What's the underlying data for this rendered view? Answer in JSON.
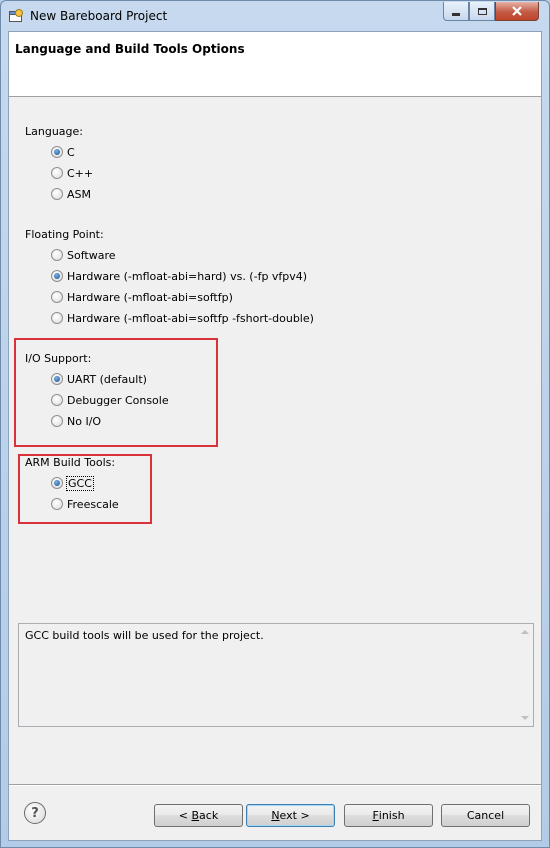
{
  "window": {
    "title": "New Bareboard Project",
    "controls": {
      "minimize": "minimize",
      "maximize": "maximize",
      "close": "close"
    }
  },
  "banner": {
    "title": "Language and Build Tools Options"
  },
  "language": {
    "label": "Language:",
    "options": [
      "C",
      "C++",
      "ASM"
    ],
    "selected": "C"
  },
  "floating_point": {
    "label": "Floating Point:",
    "options": [
      "Software",
      "Hardware (-mfloat-abi=hard) vs. (-fp vfpv4)",
      "Hardware (-mfloat-abi=softfp)",
      "Hardware (-mfloat-abi=softfp -fshort-double)"
    ],
    "selected": "Hardware (-mfloat-abi=hard) vs. (-fp vfpv4)"
  },
  "io_support": {
    "label": "I/O Support:",
    "options": [
      "UART (default)",
      "Debugger Console",
      "No I/O"
    ],
    "selected": "UART (default)"
  },
  "arm_build_tools": {
    "label": "ARM Build Tools:",
    "options": [
      "GCC",
      "Freescale"
    ],
    "selected": "GCC"
  },
  "description": {
    "text": "GCC build tools will be used for the project."
  },
  "buttons": {
    "help": "?",
    "back": {
      "prefix": "< ",
      "mnemonic": "B",
      "rest": "ack"
    },
    "next": {
      "mnemonic": "N",
      "rest": "ext >"
    },
    "finish": {
      "mnemonic": "F",
      "rest": "inish"
    },
    "cancel": "Cancel"
  },
  "colors": {
    "highlight_box": "#d9323a",
    "dialog_bg": "#f0f0f0",
    "titlebar": "#b9d1ea"
  },
  "icons": {
    "app": "eclipse-app-icon",
    "help": "help-icon",
    "close": "close-icon",
    "minimize": "minimize-icon",
    "maximize": "maximize-icon"
  }
}
